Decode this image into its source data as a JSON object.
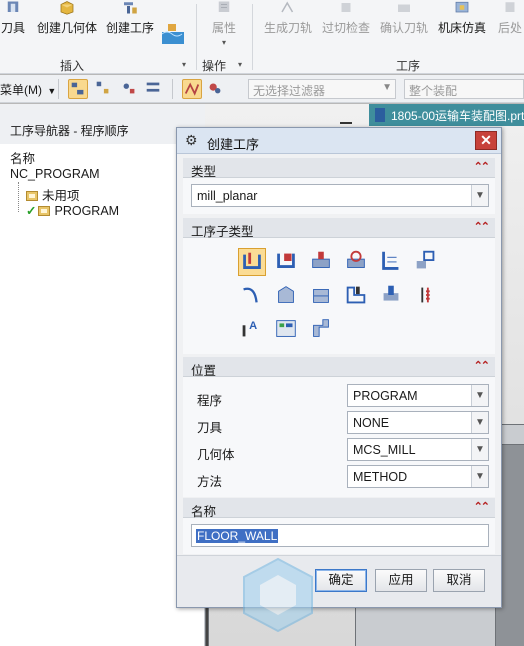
{
  "ribbon": {
    "buttons": [
      {
        "label": "刀具",
        "enabled": true,
        "icon": "tool-icon"
      },
      {
        "label": "创建几何体",
        "enabled": true,
        "icon": "geometry-icon"
      },
      {
        "label": "创建工序",
        "enabled": true,
        "icon": "operation-icon"
      },
      {
        "label": "属性",
        "enabled": false,
        "icon": "properties-icon"
      },
      {
        "label": "生成刀轨",
        "enabled": false,
        "icon": "generate-path-icon"
      },
      {
        "label": "过切检查",
        "enabled": false,
        "icon": "gouge-check-icon"
      },
      {
        "label": "确认刀轨",
        "enabled": false,
        "icon": "verify-path-icon"
      },
      {
        "label": "机床仿真",
        "enabled": true,
        "icon": "machine-sim-icon"
      },
      {
        "label": "后处",
        "enabled": false,
        "icon": "postprocess-icon"
      }
    ],
    "groups": {
      "insert": "插入",
      "operations": "操作",
      "process": "工序"
    }
  },
  "toolbar": {
    "menu_label": "菜单(M)",
    "filter_placeholder": "无选择过滤器",
    "assembly_placeholder": "整个装配"
  },
  "document_tab": {
    "title": "1805-00运输车装配图.prt"
  },
  "navigator": {
    "title": "工序导航器 - 程序顺序",
    "column_header": "名称",
    "root": "NC_PROGRAM",
    "items": [
      {
        "label": "未用项",
        "checked": false
      },
      {
        "label": "PROGRAM",
        "checked": true
      }
    ]
  },
  "dialog": {
    "title": "创建工序",
    "sections": {
      "type": {
        "label": "类型",
        "value": "mill_planar"
      },
      "subtype": {
        "label": "工序子类型",
        "icons": [
          "floor-wall-icon",
          "floor-wall-is-icon",
          "face-milling-icon",
          "face-milling-manual-icon",
          "planar-mill-icon",
          "planar-profile-icon",
          "cleanup-corners-icon",
          "finish-walls-icon",
          "finish-floor-icon",
          "groove-milling-icon",
          "hole-chamfer-icon",
          "thread-milling-icon",
          "planar-text-icon",
          "mill-control-icon",
          "mill-user-icon"
        ],
        "selected_index": 0
      },
      "location": {
        "label": "位置",
        "rows": [
          {
            "label": "程序",
            "value": "PROGRAM"
          },
          {
            "label": "刀具",
            "value": "NONE"
          },
          {
            "label": "几何体",
            "value": "MCS_MILL"
          },
          {
            "label": "方法",
            "value": "METHOD"
          }
        ]
      },
      "name": {
        "label": "名称",
        "value": "FLOOR_WALL"
      }
    },
    "buttons": {
      "ok": "确定",
      "apply": "应用",
      "cancel": "取消"
    }
  },
  "colors": {
    "accent_selected": "#fbdc95",
    "close_red": "#c7423b",
    "selection_blue": "#3f6fc4",
    "doc_tab": "#3f8e9c"
  }
}
